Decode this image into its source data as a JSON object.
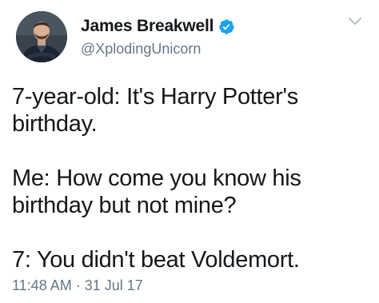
{
  "author": {
    "display_name": "James Breakwell",
    "handle": "@XplodingUnicorn",
    "verified": true,
    "avatar_icon": "profile-photo"
  },
  "tweet": {
    "paragraphs": [
      "7-year-old: It's Harry Potter's birthday.",
      "Me: How come you know his birthday but not mine?",
      "7: You didn't beat Voldemort."
    ],
    "time": "11:48 AM",
    "separator": "·",
    "date": "31 Jul 17"
  },
  "colors": {
    "verified": "#1da1f2",
    "secondary_text": "#657786",
    "primary_text": "#14171a"
  },
  "icons": {
    "verified": "verified-badge-icon",
    "menu": "chevron-down-icon"
  }
}
